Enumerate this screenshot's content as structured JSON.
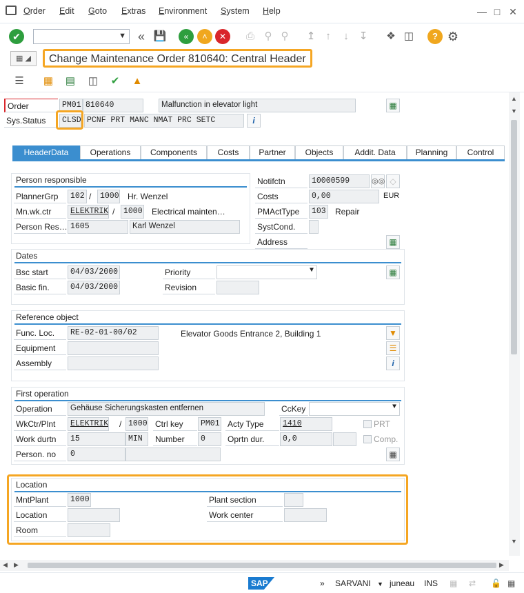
{
  "menu": [
    "Order",
    "Edit",
    "Goto",
    "Extras",
    "Environment",
    "System",
    "Help"
  ],
  "title": "Change Maintenance Order 810640: Central Header",
  "header": {
    "order_label": "Order",
    "order_type": "PM01",
    "order_number": "810640",
    "order_desc": "Malfunction in elevator light",
    "sysstatus_label": "Sys.Status",
    "sysstatus_first": "CLSD",
    "sysstatus_rest": "PCNF PRT  MANC NMAT PRC  SETC"
  },
  "tabs": [
    "HeaderData",
    "Operations",
    "Components",
    "Costs",
    "Partner",
    "Objects",
    "Addit. Data",
    "Planning",
    "Control"
  ],
  "person_responsible": {
    "title": "Person responsible",
    "plannergrp_label": "PlannerGrp",
    "plannergrp": "102",
    "plannergrp_sep": "/",
    "plannergrp_plant": "1000",
    "plannergrp_name": "Hr. Wenzel",
    "mnwkctr_label": "Mn.wk.ctr",
    "mnwkctr": "ELEKTRIK",
    "mnwkctr_sep": "/",
    "mnwkctr_plant": "1000",
    "mnwkctr_name": "Electrical mainten…",
    "personres_label": "Person Res…",
    "personres": "1605",
    "personres_name": "Karl Wenzel"
  },
  "notif": {
    "notifctn_label": "Notifctn",
    "notifctn": "10000599",
    "costs_label": "Costs",
    "costs": "0,00",
    "currency": "EUR",
    "pmacttype_label": "PMActType",
    "pmacttype": "103",
    "pmacttype_name": "Repair",
    "systcond_label": "SystCond.",
    "address_label": "Address"
  },
  "dates": {
    "title": "Dates",
    "bsc_start_label": "Bsc start",
    "bsc_start": "04/03/2000",
    "basic_fin_label": "Basic fin.",
    "basic_fin": "04/03/2000",
    "priority_label": "Priority",
    "revision_label": "Revision"
  },
  "reference": {
    "title": "Reference object",
    "funcloc_label": "Func. Loc.",
    "funcloc": "RE-02-01-00/02",
    "funcloc_desc": "Elevator Goods Entrance 2, Building 1",
    "equipment_label": "Equipment",
    "assembly_label": "Assembly"
  },
  "first_op": {
    "title": "First operation",
    "operation_label": "Operation",
    "operation": "Gehäuse Sicherungskasten entfernen",
    "cckey_label": "CcKey",
    "wkctr_label": "WkCtr/Plnt",
    "wkctr": "ELEKTRIK",
    "wkctr_sep": "/",
    "wkctr_plant": "1000",
    "ctrlkey_label": "Ctrl key",
    "ctrlkey": "PM01",
    "actytype_label": "Acty Type",
    "actytype": "1410",
    "prt_label": "PRT",
    "workdurtn_label": "Work durtn",
    "workdurtn": "15",
    "workunit": "MIN",
    "number_label": "Number",
    "number": "0",
    "oprtndur_label": "Oprtn dur.",
    "oprtndur": "0,0",
    "comp_label": "Comp.",
    "personno_label": "Person. no",
    "personno": "0"
  },
  "location": {
    "title": "Location",
    "mntplant_label": "MntPlant",
    "mntplant": "1000",
    "location_label": "Location",
    "room_label": "Room",
    "plantsection_label": "Plant section",
    "workcenter_label": "Work center"
  },
  "status": {
    "sap": "SAP",
    "arrows": "»",
    "system": "SARVANI",
    "client": "juneau",
    "mode": "INS"
  },
  "colors": {
    "accent": "#3b8ecf",
    "highlight": "#f5a623",
    "enter": "#2e9e3e"
  }
}
